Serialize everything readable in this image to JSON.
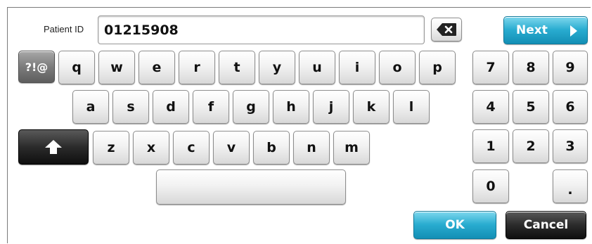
{
  "patient": {
    "label": "Patient ID",
    "value": "01215908"
  },
  "buttons": {
    "next": "Next",
    "ok": "OK",
    "cancel": "Cancel",
    "symbols": "?!@",
    "backspace_icon": "backspace-icon",
    "shift_icon": "shift-up-arrow-icon",
    "space": ""
  },
  "keyboard": {
    "row1": [
      "q",
      "w",
      "e",
      "r",
      "t",
      "y",
      "u",
      "i",
      "o",
      "p"
    ],
    "row2": [
      "a",
      "s",
      "d",
      "f",
      "g",
      "h",
      "j",
      "k",
      "l"
    ],
    "row3": [
      "z",
      "x",
      "c",
      "v",
      "b",
      "n",
      "m"
    ]
  },
  "numpad": {
    "row1": [
      "7",
      "8",
      "9"
    ],
    "row2": [
      "4",
      "5",
      "6"
    ],
    "row3": [
      "1",
      "2",
      "3"
    ],
    "zero": "0",
    "dot": "."
  },
  "colors": {
    "accent": "#29acd0",
    "dark_key": "#1a1a1a"
  }
}
